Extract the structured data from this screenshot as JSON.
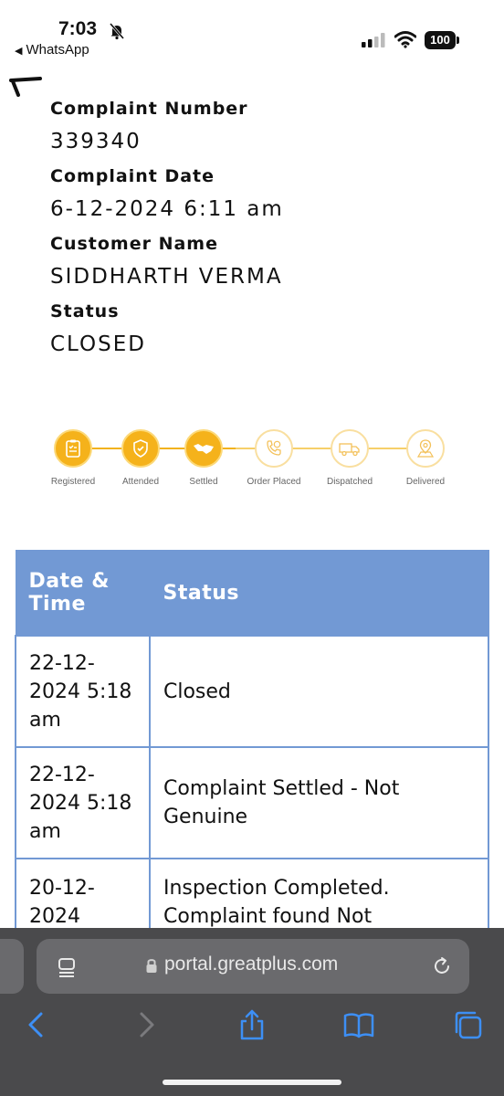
{
  "status_bar": {
    "time": "7:03",
    "back_app": "WhatsApp",
    "battery": "100"
  },
  "complaint": {
    "number_label": "Complaint Number",
    "number_value": "339340",
    "date_label": "Complaint Date",
    "date_value": "6-12-2024 6:11 am",
    "customer_label": "Customer Name",
    "customer_value": "SIDDHARTH VERMA",
    "status_label": "Status",
    "status_value": "CLOSED"
  },
  "tracker": {
    "steps": [
      {
        "label": "Registered",
        "icon": "clipboard-icon",
        "completed": true
      },
      {
        "label": "Attended",
        "icon": "shield-check-icon",
        "completed": true
      },
      {
        "label": "Settled",
        "icon": "handshake-icon",
        "completed": true
      },
      {
        "label": "Order Placed",
        "icon": "phone-call-icon",
        "completed": false
      },
      {
        "label": "Dispatched",
        "icon": "truck-icon",
        "completed": false
      },
      {
        "label": "Delivered",
        "icon": "location-pin-icon",
        "completed": false
      }
    ],
    "accent": "#f5b21b"
  },
  "history_table": {
    "headers": [
      "Date & Time",
      "Status"
    ],
    "rows": [
      {
        "date": "22-12-2024 5:18 am",
        "status": "Closed"
      },
      {
        "date": "22-12-2024 5:18 am",
        "status": "Complaint Settled - Not Genuine"
      },
      {
        "date": "20-12-2024",
        "status": "Inspection Completed. Complaint found Not"
      }
    ],
    "header_color": "#7299d4"
  },
  "browser": {
    "url": "portal.greatplus.com"
  }
}
